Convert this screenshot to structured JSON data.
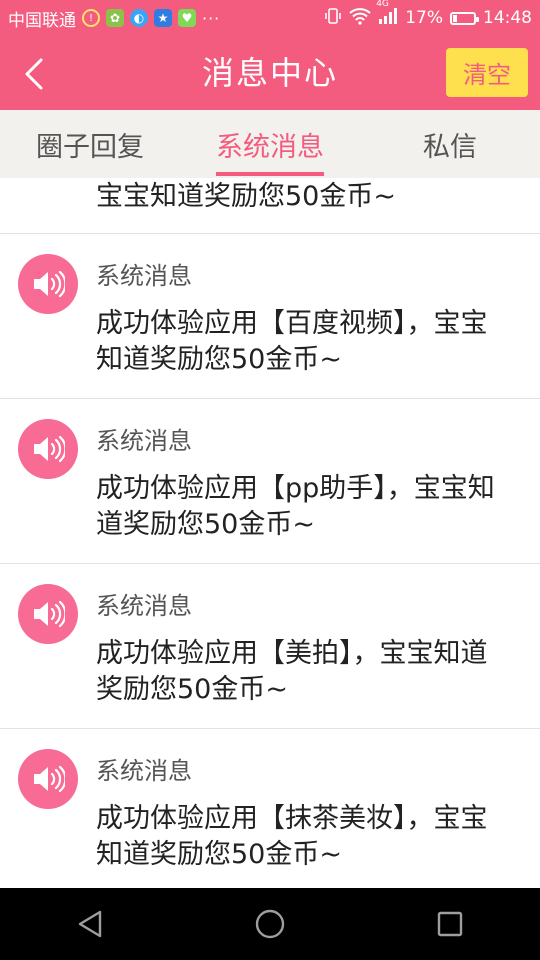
{
  "status_bar": {
    "carrier": "中国联通",
    "network_type": "4G",
    "battery": "17%",
    "battery_level": 0.17,
    "time": "14:48",
    "more": "···"
  },
  "header": {
    "title": "消息中心",
    "clear_label": "清空"
  },
  "tabs": [
    {
      "label": "圈子回复",
      "active": false
    },
    {
      "label": "系统消息",
      "active": true
    },
    {
      "label": "私信",
      "active": false
    }
  ],
  "messages": {
    "partial_body": "宝宝知道奖励您50金币~",
    "items": [
      {
        "title": "系统消息",
        "body": "成功体验应用【百度视频】，宝宝知道奖励您50金币~"
      },
      {
        "title": "系统消息",
        "body": "成功体验应用【pp助手】，宝宝知道奖励您50金币~"
      },
      {
        "title": "系统消息",
        "body": "成功体验应用【美拍】，宝宝知道奖励您50金币~"
      },
      {
        "title": "系统消息",
        "body": "成功体验应用【抹茶美妆】，宝宝知道奖励您50金币~"
      }
    ]
  },
  "colors": {
    "primary": "#f45c7f",
    "clear_button": "#fee04f",
    "avatar": "#f76b95",
    "tab_bar": "#f3f1ee"
  },
  "icons": {
    "back": "chevron-left-icon",
    "message": "speaker-icon",
    "nav_back": "triangle-back-icon",
    "nav_home": "circle-home-icon",
    "nav_recent": "square-recent-icon"
  }
}
